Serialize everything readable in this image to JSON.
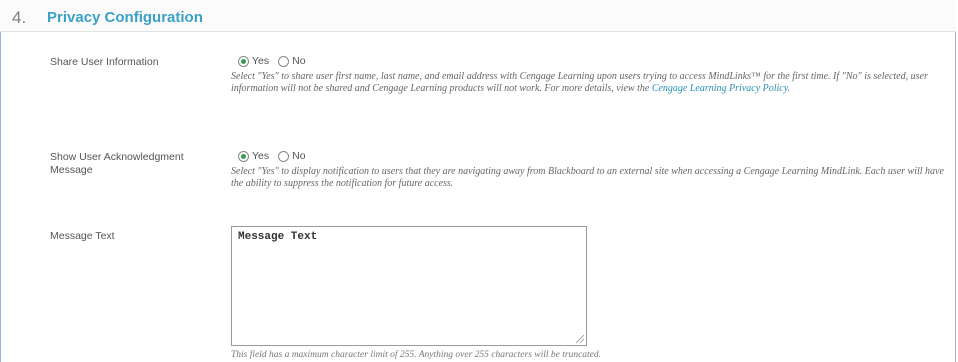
{
  "section": {
    "number": "4.",
    "title": "Privacy Configuration"
  },
  "share_user_info": {
    "label": "Share User Information",
    "options": [
      "Yes",
      "No"
    ],
    "selected": "Yes",
    "description_before_link": "Select \"Yes\" to share user first name, last name, and email address with Cengage Learning upon users trying to access MindLinks™ for the first time. If \"No\" is selected, user information will not be shared and Cengage Learning products will not work. For more details, view the ",
    "link_text": "Cengage Learning Privacy Policy",
    "description_after_link": "."
  },
  "show_acknowledgment": {
    "label": "Show User Acknowledgment Message",
    "options": [
      "Yes",
      "No"
    ],
    "selected": "Yes",
    "description": "Select \"Yes\" to display notification to users that they are navigating away from Blackboard to an external site when accessing a Cengage Learning MindLink. Each user will have the ability to suppress the notification for future access."
  },
  "message_text": {
    "label": "Message Text",
    "value": "Message Text",
    "hint": "This field has a maximum character limit of 255. Anything over 255 characters will be truncated."
  },
  "colors": {
    "title": "#3aa0c8",
    "link": "#2b8fb8",
    "radio_checked": "#3a9a4a",
    "frame_border": "#9fb4d6"
  }
}
